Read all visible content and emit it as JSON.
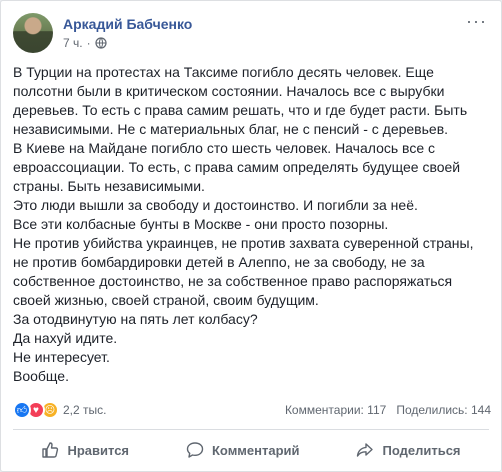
{
  "post": {
    "author": "Аркадий Бабченко",
    "time": "7 ч.",
    "menu_icon": "more-icon",
    "privacy_icon": "globe-icon",
    "lines": [
      "В Турции на протестах на Таксиме погибло десять человек. Еще",
      "полсотни были в критическом состоянии. Началось все с вырубки",
      "деревьев. То есть с права самим решать, что и где будет расти. Быть",
      "независимыми. Не с материальных благ, не с пенсий - с деревьев.",
      "В Киеве на Майдане погибло сто шесть человек. Началось все с",
      "евроассоциации. То есть, с права самим определять будущее своей",
      "страны. Быть независимыми.",
      "Это люди вышли за свободу и достоинство. И погибли за неё.",
      "Все эти колбасные бунты в Москве - они просто позорны.",
      "Не против убийства украинцев, не против захвата суверенной страны,",
      "не против бомбардировки детей в Алеппо, не за свободу, не за",
      "собственное достоинство, не за собственное право распоряжаться",
      "своей жизнью, своей страной, своим будущим.",
      "За отодвинутую на пять лет колбасу?",
      "Да нахуй идите.",
      "Не интересует.",
      "Вообще."
    ]
  },
  "reactions": {
    "icons": [
      "like-icon",
      "love-icon",
      "sad-icon"
    ],
    "count": "2,2 тыс.",
    "comments": "Комментарии: 117",
    "shares": "Поделились: 144"
  },
  "actions": {
    "like": "Нравится",
    "comment": "Комментарий",
    "share": "Поделиться"
  }
}
